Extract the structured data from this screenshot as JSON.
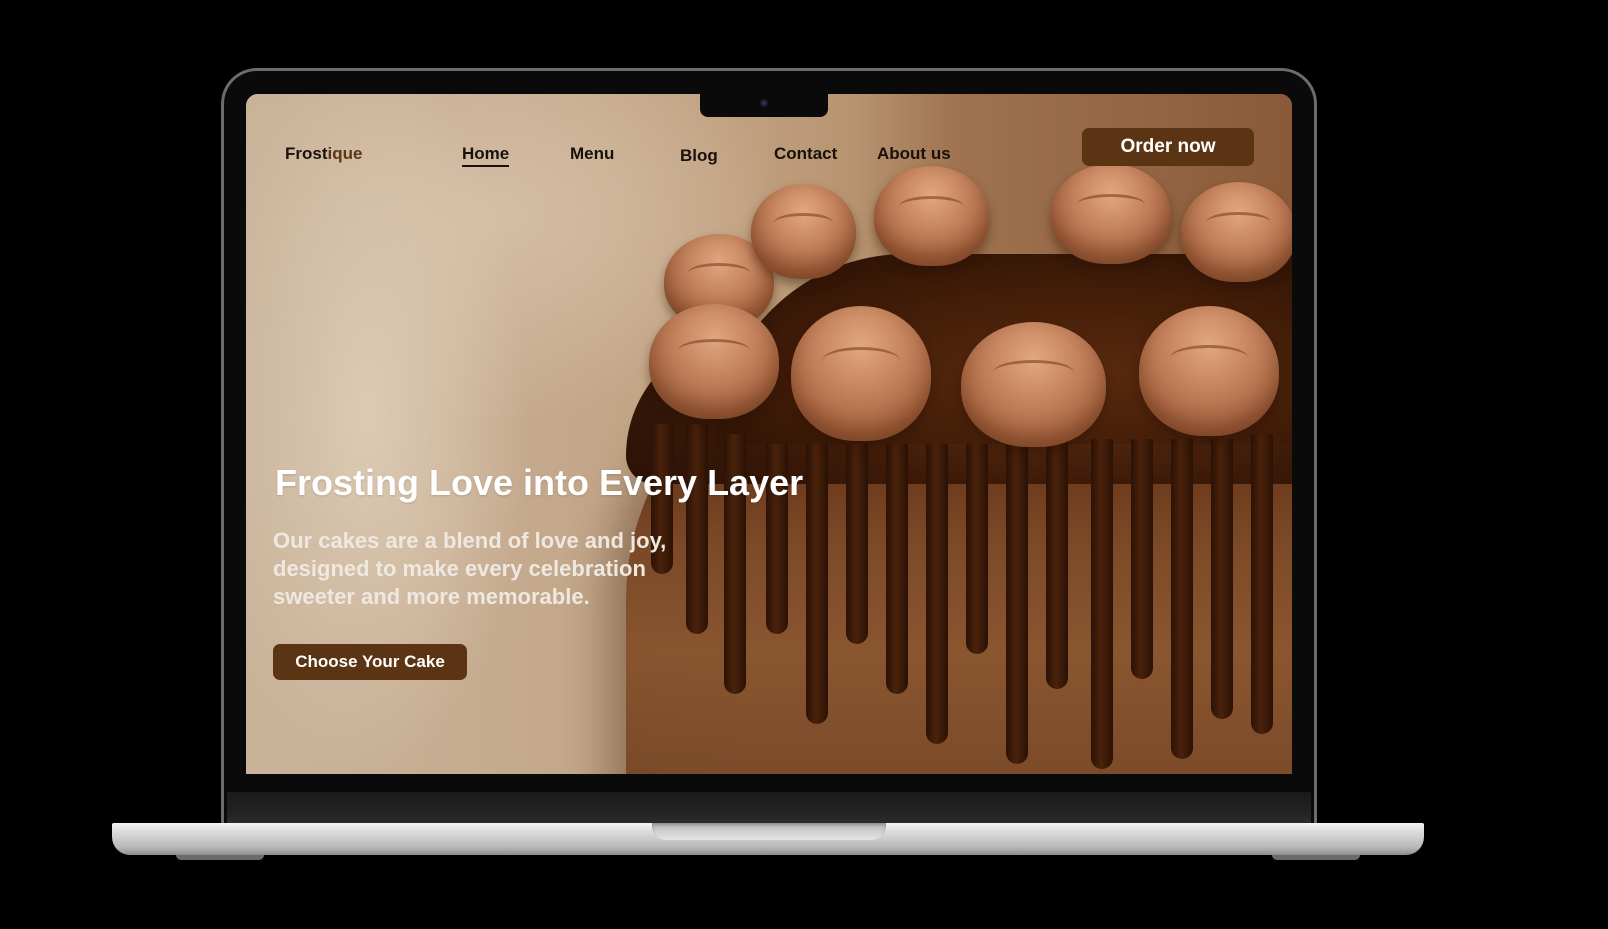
{
  "brand": {
    "name_part1": "Frost",
    "name_part2": "ique"
  },
  "nav": {
    "items": [
      {
        "label": "Home",
        "active": true
      },
      {
        "label": "Menu",
        "active": false
      },
      {
        "label": "Blog",
        "active": false
      },
      {
        "label": "Contact",
        "active": false
      },
      {
        "label": "About us",
        "active": false
      }
    ],
    "order_button": "Order now"
  },
  "hero": {
    "title": "Frosting Love into Every Layer",
    "subtitle": "Our cakes are a blend of love and joy, designed to make every celebration sweeter and more memorable.",
    "cta": "Choose Your Cake",
    "image": "chocolate-drip-cake-photo"
  },
  "colors": {
    "accent": "#5a3413",
    "brand_accent": "#5c3616",
    "nav_text": "#18110b",
    "hero_text": "#ffffff",
    "page_background": "#000000"
  }
}
